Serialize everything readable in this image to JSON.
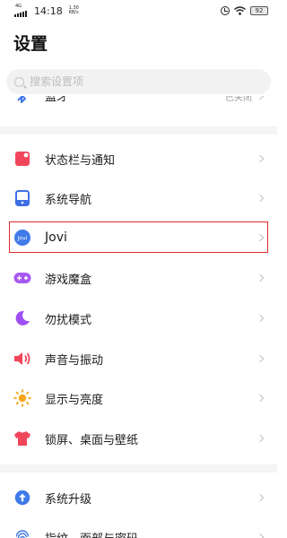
{
  "status_bar": {
    "network": "4G",
    "time": "14:18",
    "speed_value": "1.30",
    "speed_unit": "KB/s",
    "battery": "92"
  },
  "page": {
    "title": "设置"
  },
  "search": {
    "placeholder": "搜索设置项"
  },
  "partial_item": {
    "label": "蓝牙",
    "value": "已关闭"
  },
  "items": [
    {
      "label": "状态栏与通知",
      "icon": "status-bar-notification-icon",
      "color": "#f0465b"
    },
    {
      "label": "系统导航",
      "icon": "navigation-icon",
      "color": "#3f6fe6"
    },
    {
      "label": "Jovi",
      "icon": "jovi-icon",
      "color": "#3f7ae8"
    },
    {
      "label": "游戏魔盒",
      "icon": "gamepad-icon",
      "color": "#a758f0"
    },
    {
      "label": "勿扰模式",
      "icon": "moon-icon",
      "color": "#9f4ff2"
    },
    {
      "label": "声音与振动",
      "icon": "speaker-icon",
      "color": "#f2455b"
    },
    {
      "label": "显示与亮度",
      "icon": "sun-icon",
      "color": "#f6a71e"
    },
    {
      "label": "锁屏、桌面与壁纸",
      "icon": "shirt-icon",
      "color": "#f0465b"
    },
    {
      "label": "系统升级",
      "icon": "upgrade-icon",
      "color": "#3f7ae8"
    },
    {
      "label": "指纹、面部与密码",
      "icon": "fingerprint-icon",
      "color": "#3f7ae8"
    }
  ],
  "highlight_color": "#e02a2a"
}
